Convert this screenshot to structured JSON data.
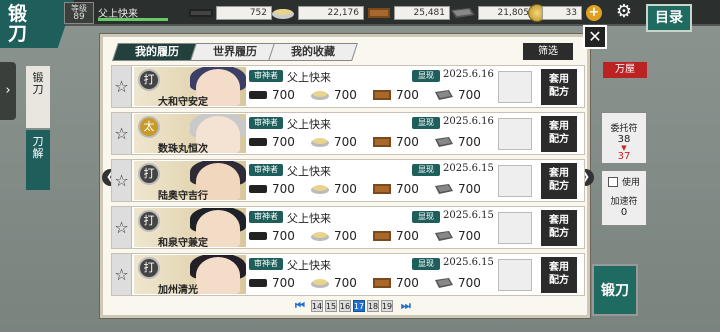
{
  "header": {
    "title": "锻刀",
    "rank_label": "等级",
    "rank_value": "89",
    "player_name": "父上快来",
    "resources": [
      "752",
      "22,176",
      "25,481",
      "21,805"
    ],
    "coins": "33",
    "catalog_label": "目录"
  },
  "side": {
    "menu": [
      "锻刀",
      "刀解"
    ],
    "manor_label": "万屋",
    "request_label": "委托符",
    "request_have": "38",
    "request_after": "37",
    "use_label": "使用",
    "speed_label": "加速符",
    "speed_value": "0",
    "forge_button": "锻刀"
  },
  "modal": {
    "tabs": [
      "我的履历",
      "世界履历",
      "我的收藏"
    ],
    "filter_label": "筛选",
    "close_symbol": "✕",
    "prev_symbol": "❮",
    "next_symbol": "❯",
    "saniwa_label": "审神者",
    "appear_label": "显现",
    "apply_label_1": "套用",
    "apply_label_2": "配方",
    "rows": [
      {
        "type": "打",
        "sword": "大和守安定",
        "saniwa": "父上快来",
        "date": "2025.6.16",
        "mats": [
          "700",
          "700",
          "700",
          "700"
        ],
        "hair_color": "#3b3f66",
        "skin": "#f3ddc8"
      },
      {
        "type": "太",
        "sword": "数珠丸恒次",
        "saniwa": "父上快来",
        "date": "2025.6.16",
        "mats": [
          "700",
          "700",
          "700",
          "700"
        ],
        "hair_color": "#c9c9c9",
        "skin": "#f4e3d2"
      },
      {
        "type": "打",
        "sword": "陆奥守吉行",
        "saniwa": "父上快来",
        "date": "2025.6.15",
        "mats": [
          "700",
          "700",
          "700",
          "700"
        ],
        "hair_color": "#2e2a36",
        "skin": "#f1d7bd"
      },
      {
        "type": "打",
        "sword": "和泉守兼定",
        "saniwa": "父上快来",
        "date": "2025.6.15",
        "mats": [
          "700",
          "700",
          "700",
          "700"
        ],
        "hair_color": "#1d2228",
        "skin": "#f3dcc6"
      },
      {
        "type": "打",
        "sword": "加州清光",
        "saniwa": "父上快来",
        "date": "2025.6.15",
        "mats": [
          "700",
          "700",
          "700",
          "700"
        ],
        "hair_color": "#241f26",
        "skin": "#f4ddc8"
      }
    ],
    "pager": {
      "first_symbol": "⏮",
      "last_symbol": "⏭",
      "pages": [
        "14",
        "15",
        "16",
        "17",
        "18",
        "19"
      ],
      "current": "17"
    }
  }
}
